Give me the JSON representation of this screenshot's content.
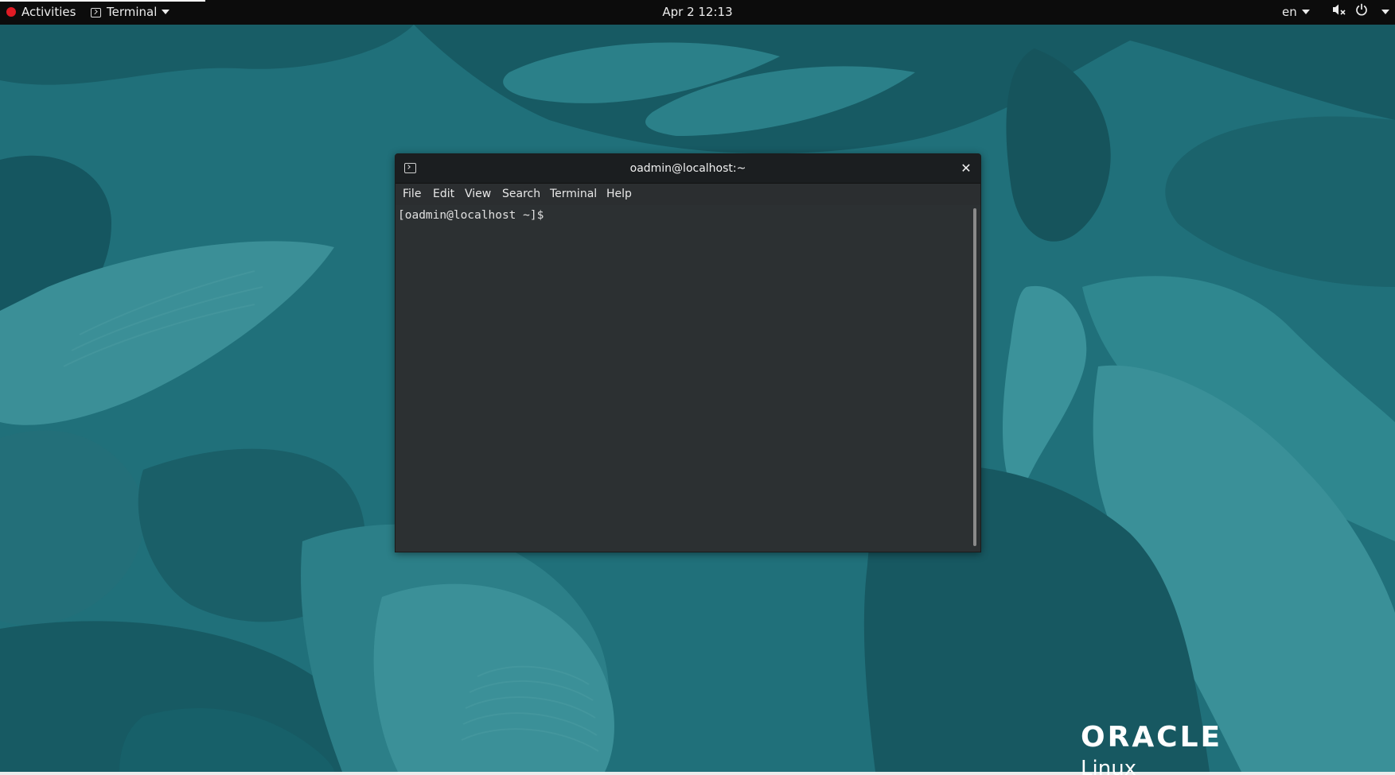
{
  "topbar": {
    "activities_label": "Activities",
    "app_menu_label": "Terminal",
    "clock": "Apr 2  12:13",
    "language": "en",
    "icons": [
      "volume-muted-icon",
      "power-icon",
      "chevron-down-icon"
    ]
  },
  "window": {
    "title": "oadmin@localhost:~",
    "close_glyph": "✕",
    "menu": [
      "File",
      "Edit",
      "View",
      "Search",
      "Terminal",
      "Help"
    ]
  },
  "terminal": {
    "prompt": "[oadmin@localhost ~]$ "
  },
  "branding": {
    "logo_word": "ORACLE",
    "logo_sub": "Linux"
  },
  "colors": {
    "desktop_base": "#1f6c75",
    "desktop_dark": "#134f56",
    "desktop_light": "#3a8f96",
    "topbar": "#0c0c0c",
    "terminal_bg": "#2c3032",
    "titlebar": "#1b1e20"
  }
}
